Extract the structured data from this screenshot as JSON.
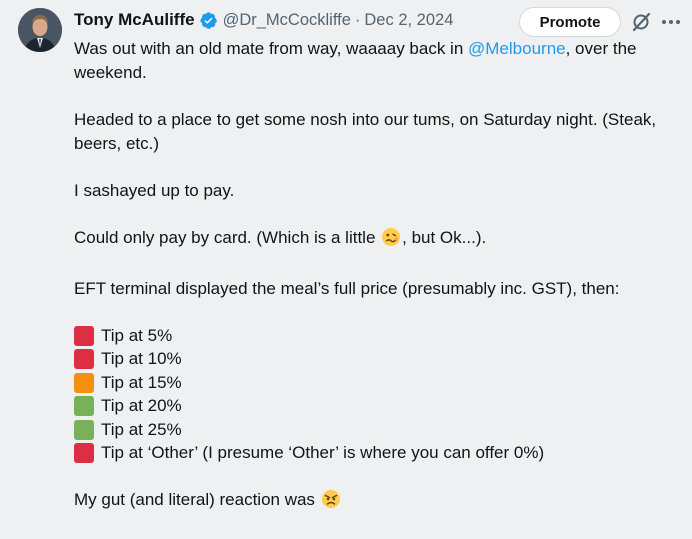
{
  "author": {
    "name": "Tony McAuliffe",
    "handle": "@Dr_McCockliffe",
    "separator": "·",
    "date": "Dec 2, 2024"
  },
  "actions": {
    "promote_label": "Promote"
  },
  "post": {
    "p1_before": "Was out with an old mate from way, waaaay back in ",
    "p1_mention": "@Melbourne",
    "p1_after": ", over the weekend.",
    "p2": "Headed to a place to get some nosh into our tums, on Saturday night. (Steak, beers, etc.)",
    "p3": "I sashayed up to pay.",
    "p4_before": "Could only pay by card. (Which is a little ",
    "p4_emoji": "woozy-face",
    "p4_after": ", but Ok...).",
    "p5": "EFT terminal displayed the meal’s full price (presumably inc. GST), then:",
    "tips": [
      {
        "label": "Tip at 5%",
        "color": "#dd2e44"
      },
      {
        "label": "Tip at 10%",
        "color": "#dd2e44"
      },
      {
        "label": "Tip at 15%",
        "color": "#f4900c"
      },
      {
        "label": "Tip at 20%",
        "color": "#78b159"
      },
      {
        "label": "Tip at 25%",
        "color": "#78b159"
      },
      {
        "label": "Tip at ‘Other’ (I presume ‘Other’ is where you can offer 0%)",
        "color": "#dd2e44"
      }
    ],
    "p6": "My gut (and literal) reaction was ",
    "p6_emoji": "angry-face"
  },
  "colors": {
    "background": "#eff0f1",
    "text": "#0f1419",
    "muted": "#536471",
    "link": "#1d9bf0",
    "verified": "#1d9bf0"
  }
}
